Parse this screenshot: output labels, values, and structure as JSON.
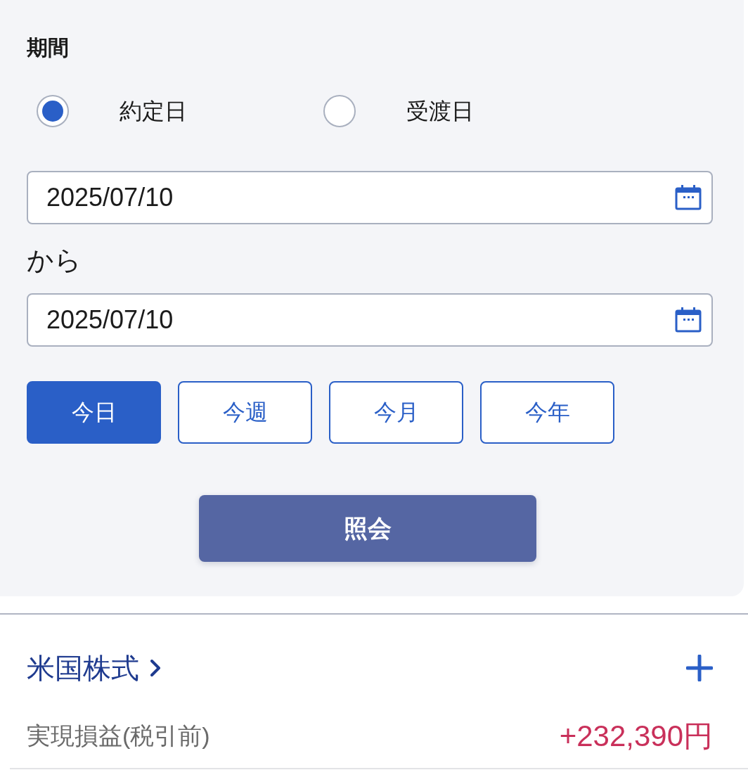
{
  "period": {
    "label": "期間",
    "date_type_options": [
      {
        "label": "約定日",
        "selected": true
      },
      {
        "label": "受渡日",
        "selected": false
      }
    ],
    "start_date": {
      "value": "2025/07/10"
    },
    "range_separator": "から",
    "end_date": {
      "value": "2025/07/10"
    },
    "quick_ranges": [
      {
        "label": "今日",
        "selected": true
      },
      {
        "label": "今週",
        "selected": false
      },
      {
        "label": "今月",
        "selected": false
      },
      {
        "label": "今年",
        "selected": false
      }
    ],
    "submit_button": "照会"
  },
  "section": {
    "title": "米国株式",
    "rows": [
      {
        "label": "実現損益(税引前)",
        "value": "+232,390円"
      }
    ]
  }
}
